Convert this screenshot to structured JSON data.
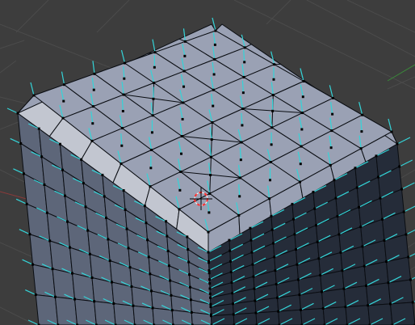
{
  "viewport": {
    "mode": "edit-mode",
    "object": "subdivided-cube-mesh",
    "normals_visible": true,
    "vertices_visible": true
  },
  "colors": {
    "background": "#3d3d3d",
    "grid_line": "#4b4b4b",
    "top_face": "#9aa1b4",
    "bevel_left": "#c2c6d0",
    "left_face": "#5d6679",
    "right_face": "#252c39",
    "edge": "#0a0d12",
    "normal": "#34d4d8",
    "vertex": "#000000",
    "cursor_red": "#ff3030",
    "cursor_white": "#ffffff",
    "axis_red": "#8a3a3a",
    "axis_green": "#3a8a3a"
  }
}
